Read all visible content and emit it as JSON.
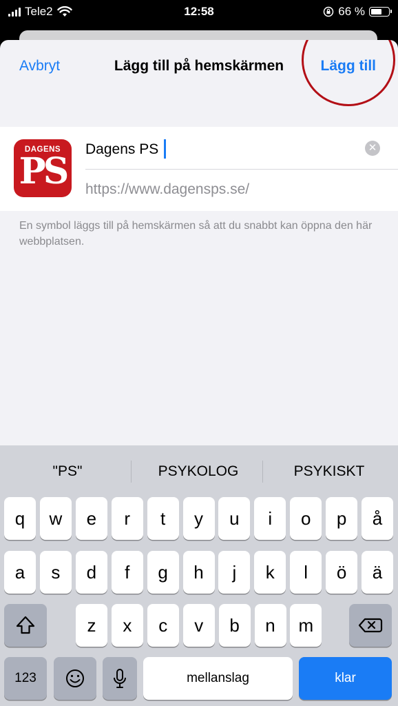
{
  "status_bar": {
    "carrier": "Tele2",
    "time": "12:58",
    "battery_percent": "66 %",
    "battery_level": 0.66
  },
  "sheet": {
    "cancel_label": "Avbryt",
    "title": "Lägg till på hemskärmen",
    "add_label": "Lägg till"
  },
  "app": {
    "icon_brand": "DAGENS",
    "icon_mark": "PS",
    "name_value": "Dagens PS",
    "url": "https://www.dagensps.se/"
  },
  "hint": "En symbol läggs till på hemskärmen så att du snabbt kan öppna den här webbplatsen.",
  "keyboard": {
    "suggestions": [
      "\"PS\"",
      "PSYKOLOG",
      "PSYKISKT"
    ],
    "row1": [
      "q",
      "w",
      "e",
      "r",
      "t",
      "y",
      "u",
      "i",
      "o",
      "p",
      "å"
    ],
    "row2": [
      "a",
      "s",
      "d",
      "f",
      "g",
      "h",
      "j",
      "k",
      "l",
      "ö",
      "ä"
    ],
    "row3": [
      "z",
      "x",
      "c",
      "v",
      "b",
      "n",
      "m"
    ],
    "numbers_label": "123",
    "space_label": "mellanslag",
    "return_label": "klar",
    "shift_icon": "shift-icon",
    "backspace_icon": "backspace-icon",
    "emoji_icon": "emoji-icon",
    "microphone_icon": "microphone-icon"
  },
  "colors": {
    "accent": "#1a7cf5",
    "brand_red": "#c8191f",
    "highlight": "#b30f16"
  }
}
